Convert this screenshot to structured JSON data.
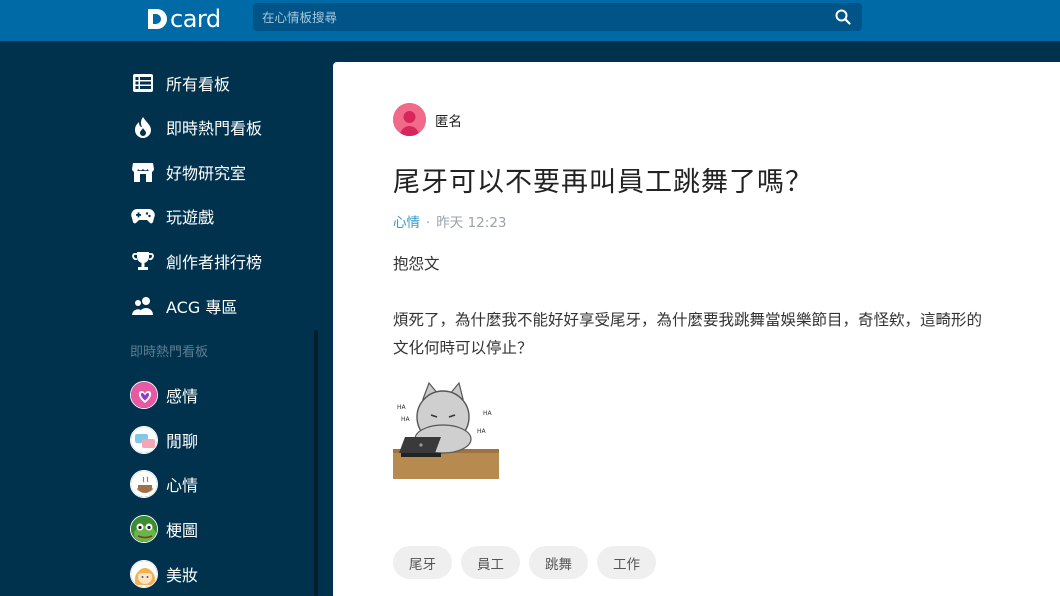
{
  "header": {
    "logo_text": "card",
    "search_placeholder": "在心情板搜尋"
  },
  "sidebar": {
    "nav_items": [
      {
        "label": "所有看板",
        "icon": "list-icon"
      },
      {
        "label": "即時熱門看板",
        "icon": "fire-icon"
      },
      {
        "label": "好物研究室",
        "icon": "store-icon"
      },
      {
        "label": "玩遊戲",
        "icon": "gamepad-icon"
      },
      {
        "label": "創作者排行榜",
        "icon": "trophy-icon"
      },
      {
        "label": "ACG 專區",
        "icon": "users-icon"
      }
    ],
    "section_title": "即時熱門看板",
    "boards": [
      {
        "label": "感情",
        "icon": "heart-avatar-icon"
      },
      {
        "label": "閒聊",
        "icon": "chat-avatar-icon"
      },
      {
        "label": "心情",
        "icon": "coffee-avatar-icon"
      },
      {
        "label": "梗圖",
        "icon": "frog-avatar-icon"
      },
      {
        "label": "美妝",
        "icon": "girl-avatar-icon"
      }
    ]
  },
  "post": {
    "author": "匿名",
    "title": "尾牙可以不要再叫員工跳舞了嗎？",
    "forum": "心情",
    "separator": "·",
    "time": "昨天 12:23",
    "body_line1": "抱怨文",
    "body_line2": "煩死了，為什麼我不能好好享受尾牙，為什麼要我跳舞當娛樂節目，奇怪欸，這畸形的",
    "body_line3": "文化何時可以停止？",
    "sticker_text": "HA",
    "tags": [
      "尾牙",
      "員工",
      "跳舞",
      "工作"
    ]
  },
  "colors": {
    "topbar": "#006aa6",
    "sidebar": "#00324e",
    "forum_link": "#3397cf"
  }
}
